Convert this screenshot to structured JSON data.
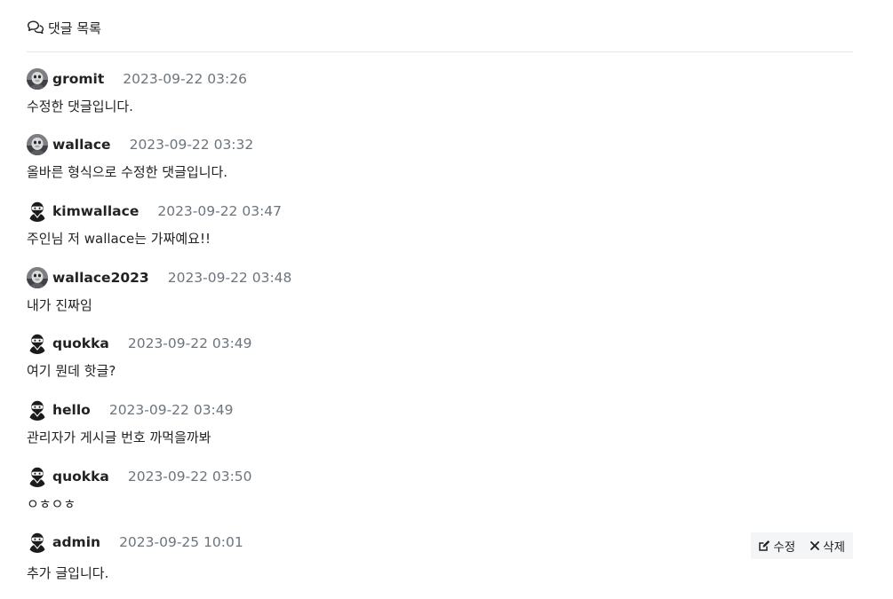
{
  "section": {
    "title": "댓글 목록",
    "icon": "comments-icon"
  },
  "comments": [
    {
      "author": "gromit",
      "date": "2023-09-22 03:26",
      "text": "수정한 댓글입니다.",
      "avatar": "photo-avatar"
    },
    {
      "author": "wallace",
      "date": "2023-09-22 03:32",
      "text": "올바른 형식으로 수정한 댓글입니다.",
      "avatar": "photo-avatar"
    },
    {
      "author": "kimwallace",
      "date": "2023-09-22 03:47",
      "text": "주인님 저 wallace는 가짜예요!!",
      "avatar": "ninja-avatar"
    },
    {
      "author": "wallace2023",
      "date": "2023-09-22 03:48",
      "text": "내가 진짜임",
      "avatar": "photo-avatar"
    },
    {
      "author": "quokka",
      "date": "2023-09-22 03:49",
      "text": "여기 뭔데 핫글?",
      "avatar": "ninja-avatar"
    },
    {
      "author": "hello",
      "date": "2023-09-22 03:49",
      "text": "관리자가 게시글 번호 까먹을까봐",
      "avatar": "ninja-avatar"
    },
    {
      "author": "quokka",
      "date": "2023-09-22 03:50",
      "text": "ㅇㅎㅇㅎ",
      "avatar": "ninja-avatar"
    },
    {
      "author": "admin",
      "date": "2023-09-25 10:01",
      "text": "추가 글입니다.",
      "avatar": "ninja-avatar"
    }
  ],
  "actions": {
    "edit_label": "수정",
    "delete_label": "삭제"
  }
}
